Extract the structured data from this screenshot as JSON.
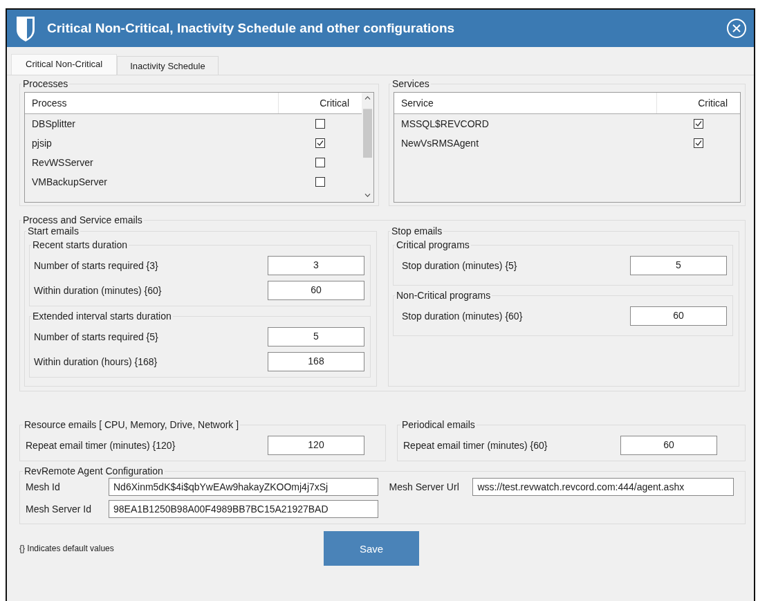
{
  "window": {
    "title": "Critical Non-Critical, Inactivity Schedule and other configurations"
  },
  "tabs": [
    {
      "label": "Critical Non-Critical",
      "selected": true
    },
    {
      "label": "Inactivity Schedule",
      "selected": false
    }
  ],
  "processes": {
    "title": "Processes",
    "columns": [
      "Process",
      "Critical"
    ],
    "rows": [
      {
        "name": "DBSplitter",
        "critical": false
      },
      {
        "name": "pjsip",
        "critical": true
      },
      {
        "name": "RevWSServer",
        "critical": false
      },
      {
        "name": "VMBackupServer",
        "critical": false
      }
    ]
  },
  "services": {
    "title": "Services",
    "columns": [
      "Service",
      "Critical"
    ],
    "rows": [
      {
        "name": "MSSQL$REVCORD",
        "critical": true
      },
      {
        "name": "NewVsRMSAgent",
        "critical": true
      }
    ]
  },
  "emails": {
    "title": "Process and Service emails",
    "start": {
      "title": "Start emails",
      "groups": [
        {
          "title": "Recent starts duration",
          "fields": [
            {
              "label": "Number of starts required {3}",
              "value": "3"
            },
            {
              "label": "Within duration (minutes) {60}",
              "value": "60"
            }
          ]
        },
        {
          "title": "Extended interval starts duration",
          "fields": [
            {
              "label": "Number of starts required {5}",
              "value": "5"
            },
            {
              "label": "Within duration (hours) {168}",
              "value": "168"
            }
          ]
        }
      ]
    },
    "stop": {
      "title": "Stop emails",
      "groups": [
        {
          "title": "Critical programs",
          "fields": [
            {
              "label": "Stop duration (minutes) {5}",
              "value": "5"
            }
          ]
        },
        {
          "title": "Non-Critical programs",
          "fields": [
            {
              "label": "Stop duration (minutes) {60}",
              "value": "60"
            }
          ]
        }
      ]
    }
  },
  "resource": {
    "title": "Resource emails [ CPU, Memory, Drive, Network ]",
    "fields": [
      {
        "label": "Repeat email timer (minutes) {120}",
        "value": "120"
      }
    ]
  },
  "periodical": {
    "title": "Periodical emails",
    "fields": [
      {
        "label": "Repeat email timer (minutes) {60}",
        "value": "60"
      }
    ]
  },
  "agent": {
    "title": "RevRemote Agent Configuration",
    "fields": [
      {
        "label": "Mesh Id",
        "value": "Nd6Xinm5dK$4i$qbYwEAw9hakayZKOOmj4j7xSj"
      },
      {
        "label": "Mesh Server Url",
        "value": "wss://test.revwatch.revcord.com:444/agent.ashx"
      },
      {
        "label": "Mesh Server Id",
        "value": "98EA1B1250B98A00F4989BB7BC15A21927BAD"
      }
    ]
  },
  "note": "{} Indicates default values",
  "buttons": [
    "Save"
  ]
}
